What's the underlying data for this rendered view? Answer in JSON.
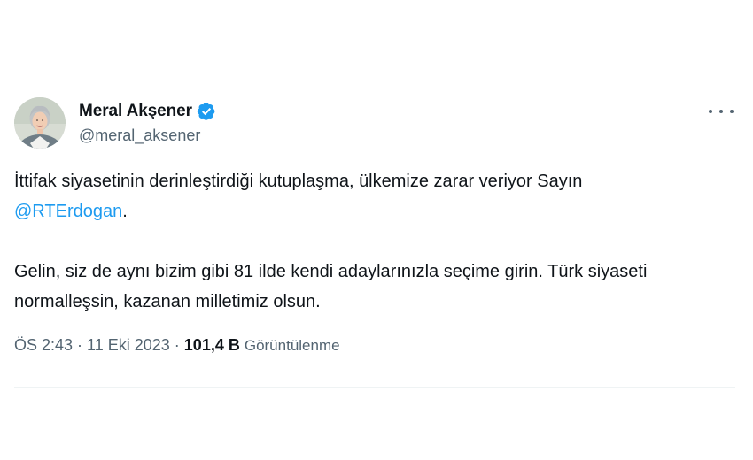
{
  "author": {
    "display_name": "Meral Akşener",
    "handle": "@meral_aksener",
    "verified": true,
    "verified_icon": "verified-badge-icon",
    "verified_color": "#1d9bf0"
  },
  "tweet": {
    "line1_text": "İttifak siyasetinin derinleştirdiği kutuplaşma, ülkemize zarar veriyor Sayın",
    "mention": "@RTErdogan",
    "mention_suffix": ".",
    "paragraph2": "Gelin, siz de aynı bizim gibi 81 ilde kendi adaylarınızla seçime girin. Türk siyaseti normalleşsin, kazanan milletimiz olsun."
  },
  "meta": {
    "time": "ÖS 2:43",
    "separator": "·",
    "date": "11 Eki 2023",
    "views_count": "101,4 B",
    "views_label": "Görüntülenme"
  },
  "colors": {
    "text": "#0f1419",
    "secondary": "#536471",
    "accent": "#1d9bf0",
    "divider": "#eff3f4"
  },
  "icons": {
    "more": "more-horizontal-icon"
  }
}
